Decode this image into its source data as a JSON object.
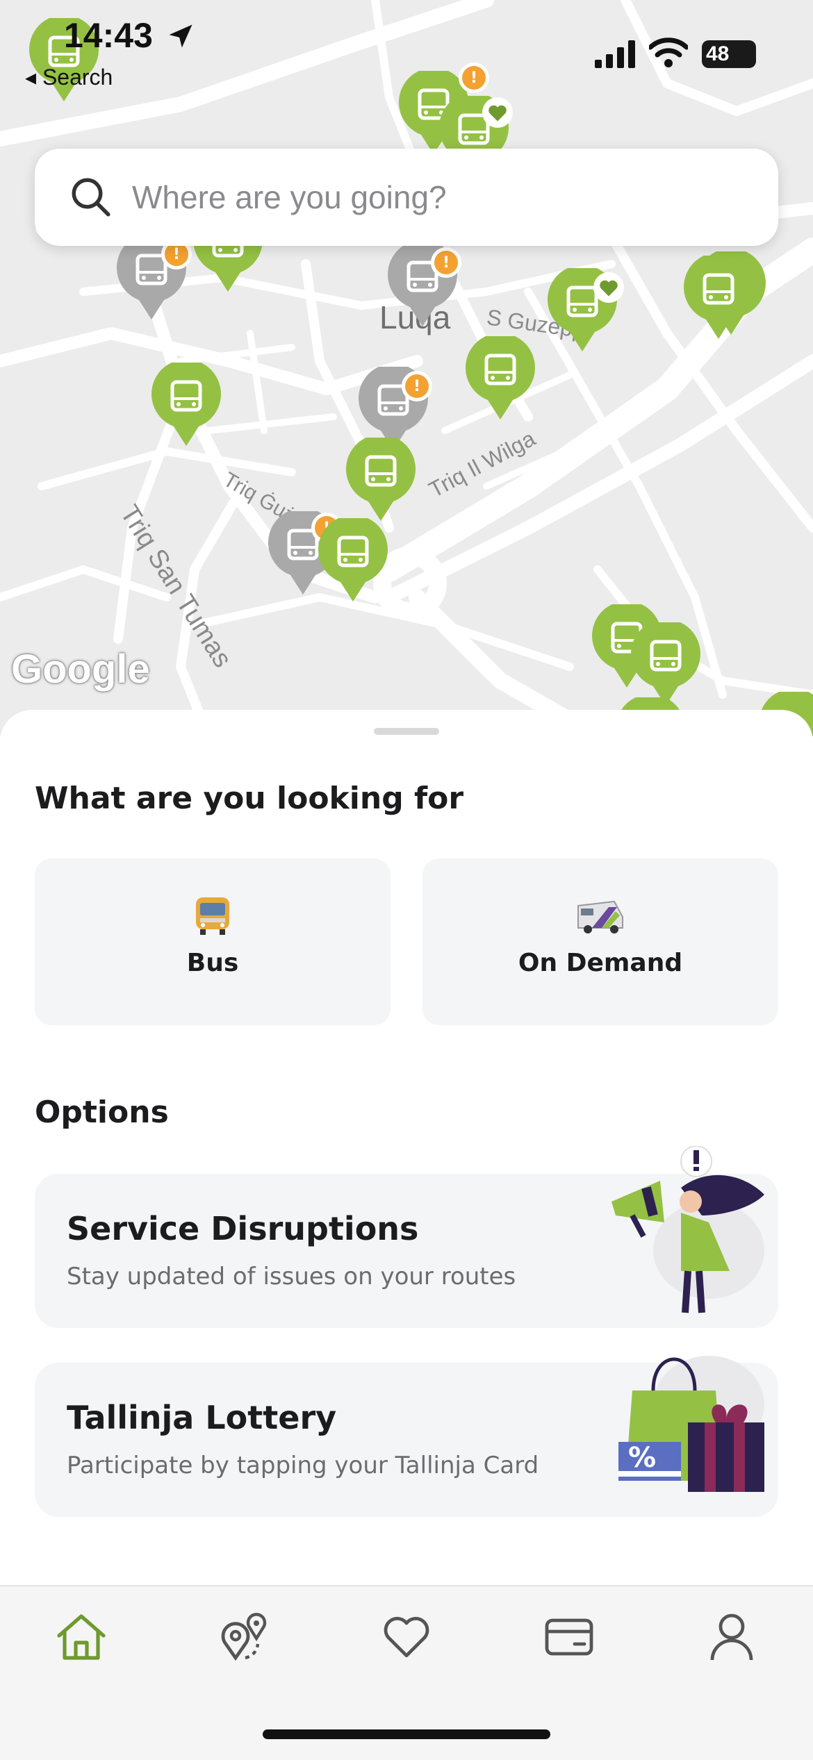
{
  "status_bar": {
    "time": "14:43",
    "back_app": "◂ Search",
    "battery": "48"
  },
  "map": {
    "labels": [
      "Luqa",
      "S Guzepp",
      "Triq Il Wilga",
      "Triq San Tumas",
      "Triq Ġuż"
    ],
    "attribution": "Google",
    "search": {
      "placeholder": "Where are you going?"
    },
    "colors": {
      "active_stop": "#94c143",
      "inactive_stop": "#a9a9a9",
      "alert": "#f3a231"
    }
  },
  "sheet": {
    "title": "What are you looking for",
    "modes": [
      {
        "label": "Bus",
        "icon": "bus-emoji-icon"
      },
      {
        "label": "On Demand",
        "icon": "on-demand-van-icon"
      }
    ],
    "options_title": "Options",
    "options": [
      {
        "title": "Service Disruptions",
        "subtitle": "Stay updated of issues on your routes",
        "icon": "megaphone-illustration"
      },
      {
        "title": "Tallinja Lottery",
        "subtitle": "Participate by tapping your Tallinja Card",
        "icon": "shopping-gift-illustration"
      }
    ]
  },
  "tabbar": {
    "items": [
      {
        "name": "home",
        "icon": "home-icon",
        "active": true
      },
      {
        "name": "routes",
        "icon": "route-pins-icon"
      },
      {
        "name": "favourites",
        "icon": "heart-icon"
      },
      {
        "name": "card",
        "icon": "card-icon"
      },
      {
        "name": "account",
        "icon": "person-icon"
      }
    ],
    "active_color": "#6f9a2e"
  }
}
